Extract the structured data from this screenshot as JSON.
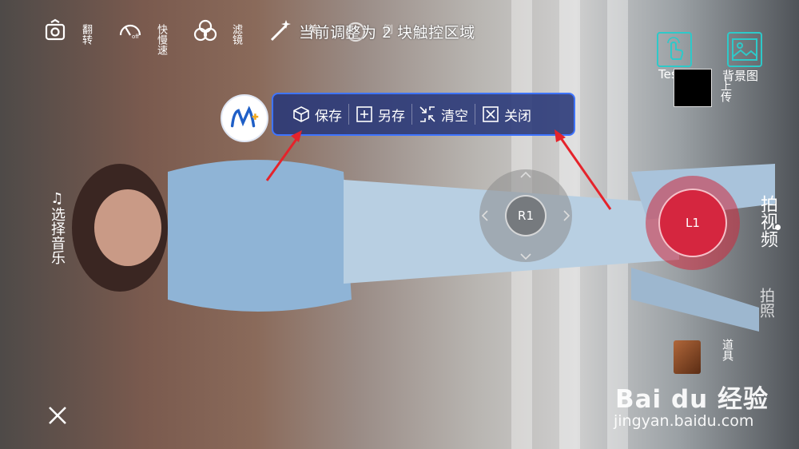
{
  "top_icons": [
    {
      "name": "flip",
      "label": "翻转"
    },
    {
      "name": "speed",
      "label": "快慢速"
    },
    {
      "name": "filter",
      "label": "滤镜"
    },
    {
      "name": "beauty",
      "label": "美"
    },
    {
      "name": "countdown",
      "label": "倒"
    }
  ],
  "notice": "当前调整为 2 块触控区域",
  "right_buttons": {
    "test_label": "Test",
    "background_label": "背景图",
    "upload_label": "上传"
  },
  "toolbar": {
    "save": "保存",
    "save_as": "另存",
    "clear": "清空",
    "close": "关闭"
  },
  "joystick_label": "R1",
  "shoot_label": "L1",
  "side": {
    "music": "选择音乐",
    "video": "拍视频",
    "photo": "拍照",
    "props": "道具"
  },
  "watermark": {
    "brand": "Bai du 经验",
    "url": "jingyan.baidu.com"
  },
  "colors": {
    "accent": "#2ec9c9",
    "toolbar_border": "#3e74ff",
    "record": "#d5263f",
    "arrow": "#e5232b"
  }
}
